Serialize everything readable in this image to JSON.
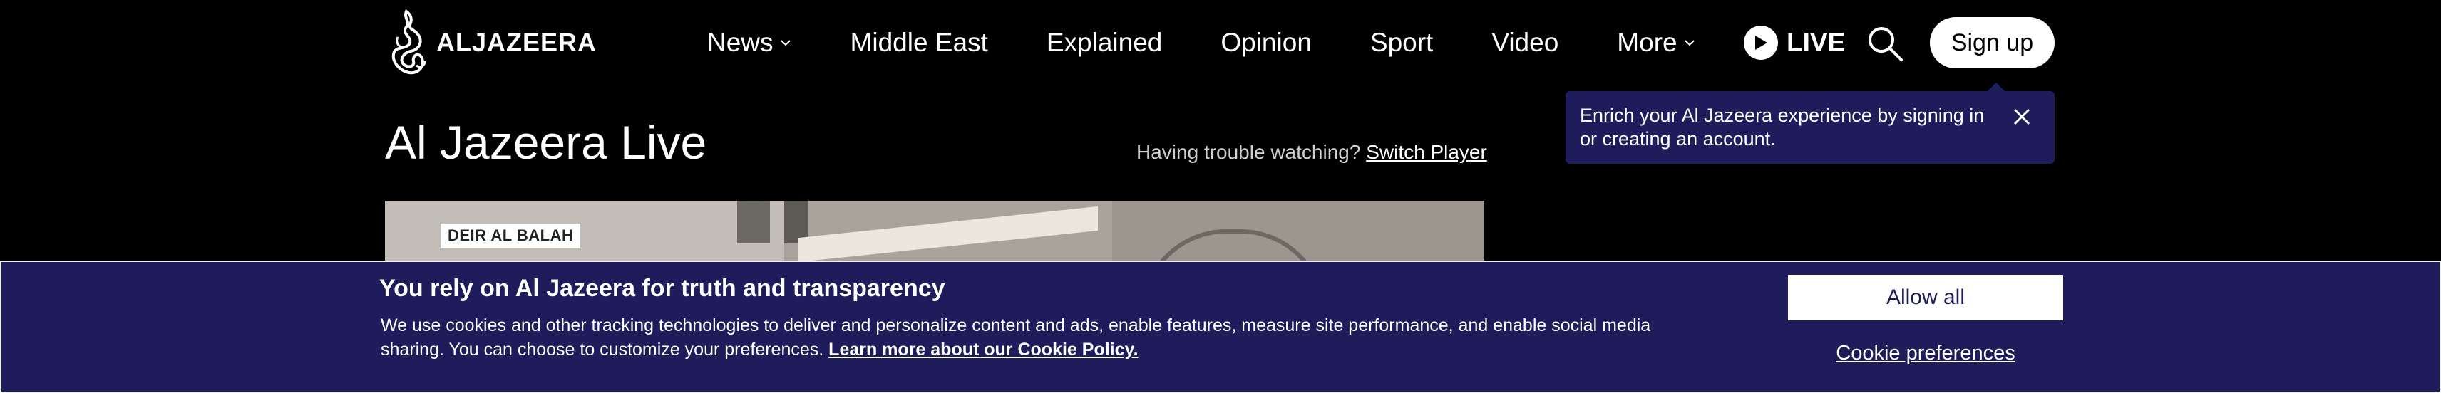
{
  "header": {
    "logo_text": "ALJAZEERA",
    "nav": [
      {
        "label": "News",
        "has_dropdown": true
      },
      {
        "label": "Middle East",
        "has_dropdown": false
      },
      {
        "label": "Explained",
        "has_dropdown": false
      },
      {
        "label": "Opinion",
        "has_dropdown": false
      },
      {
        "label": "Sport",
        "has_dropdown": false
      },
      {
        "label": "Video",
        "has_dropdown": false
      },
      {
        "label": "More",
        "has_dropdown": true
      }
    ],
    "live_label": "LIVE",
    "signup_label": "Sign up"
  },
  "tooltip": {
    "text": "Enrich your Al Jazeera experience by signing in or creating an account."
  },
  "main": {
    "title": "Al Jazeera Live",
    "trouble_text": "Having trouble watching?",
    "switch_player_label": "Switch Player",
    "video": {
      "location_tag": "DEIR AL BALAH"
    }
  },
  "cookie_banner": {
    "title": "You rely on Al Jazeera for truth and transparency",
    "body": "We use cookies and other tracking technologies to deliver and personalize content and ads, enable features, measure site performance, and enable social media sharing. You can choose to customize your preferences.",
    "policy_link": "Learn more about our Cookie Policy.",
    "allow_all_label": "Allow all",
    "preferences_label": "Cookie preferences"
  },
  "colors": {
    "background": "#000000",
    "banner_navy": "#1e1c5a",
    "text": "#ffffff"
  }
}
